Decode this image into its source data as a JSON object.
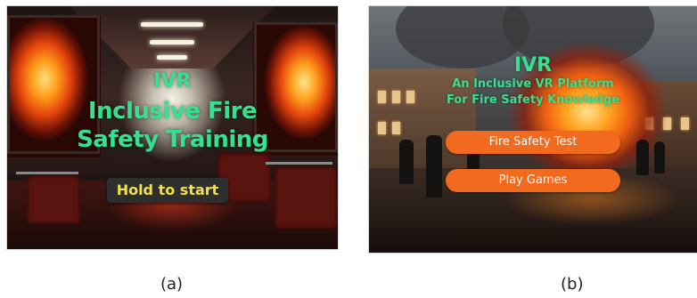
{
  "panel_a": {
    "title_lines": [
      "IVR",
      "Inclusive Fire",
      "Safety Training"
    ],
    "start_button_label": "Hold to start",
    "caption": "(a)"
  },
  "panel_b": {
    "title": "IVR",
    "subtitle_lines": [
      "An Inclusive VR Platform",
      "For Fire Safety Knowledge"
    ],
    "buttons": [
      {
        "label": "Fire Safety Test"
      },
      {
        "label": "Play Games"
      }
    ],
    "caption": "(b)"
  },
  "colors": {
    "title_green": "#35e08e",
    "start_text_yellow": "#f2e24a",
    "start_bg": "#2e2e2e",
    "menu_button_orange": "#f16a1d"
  }
}
